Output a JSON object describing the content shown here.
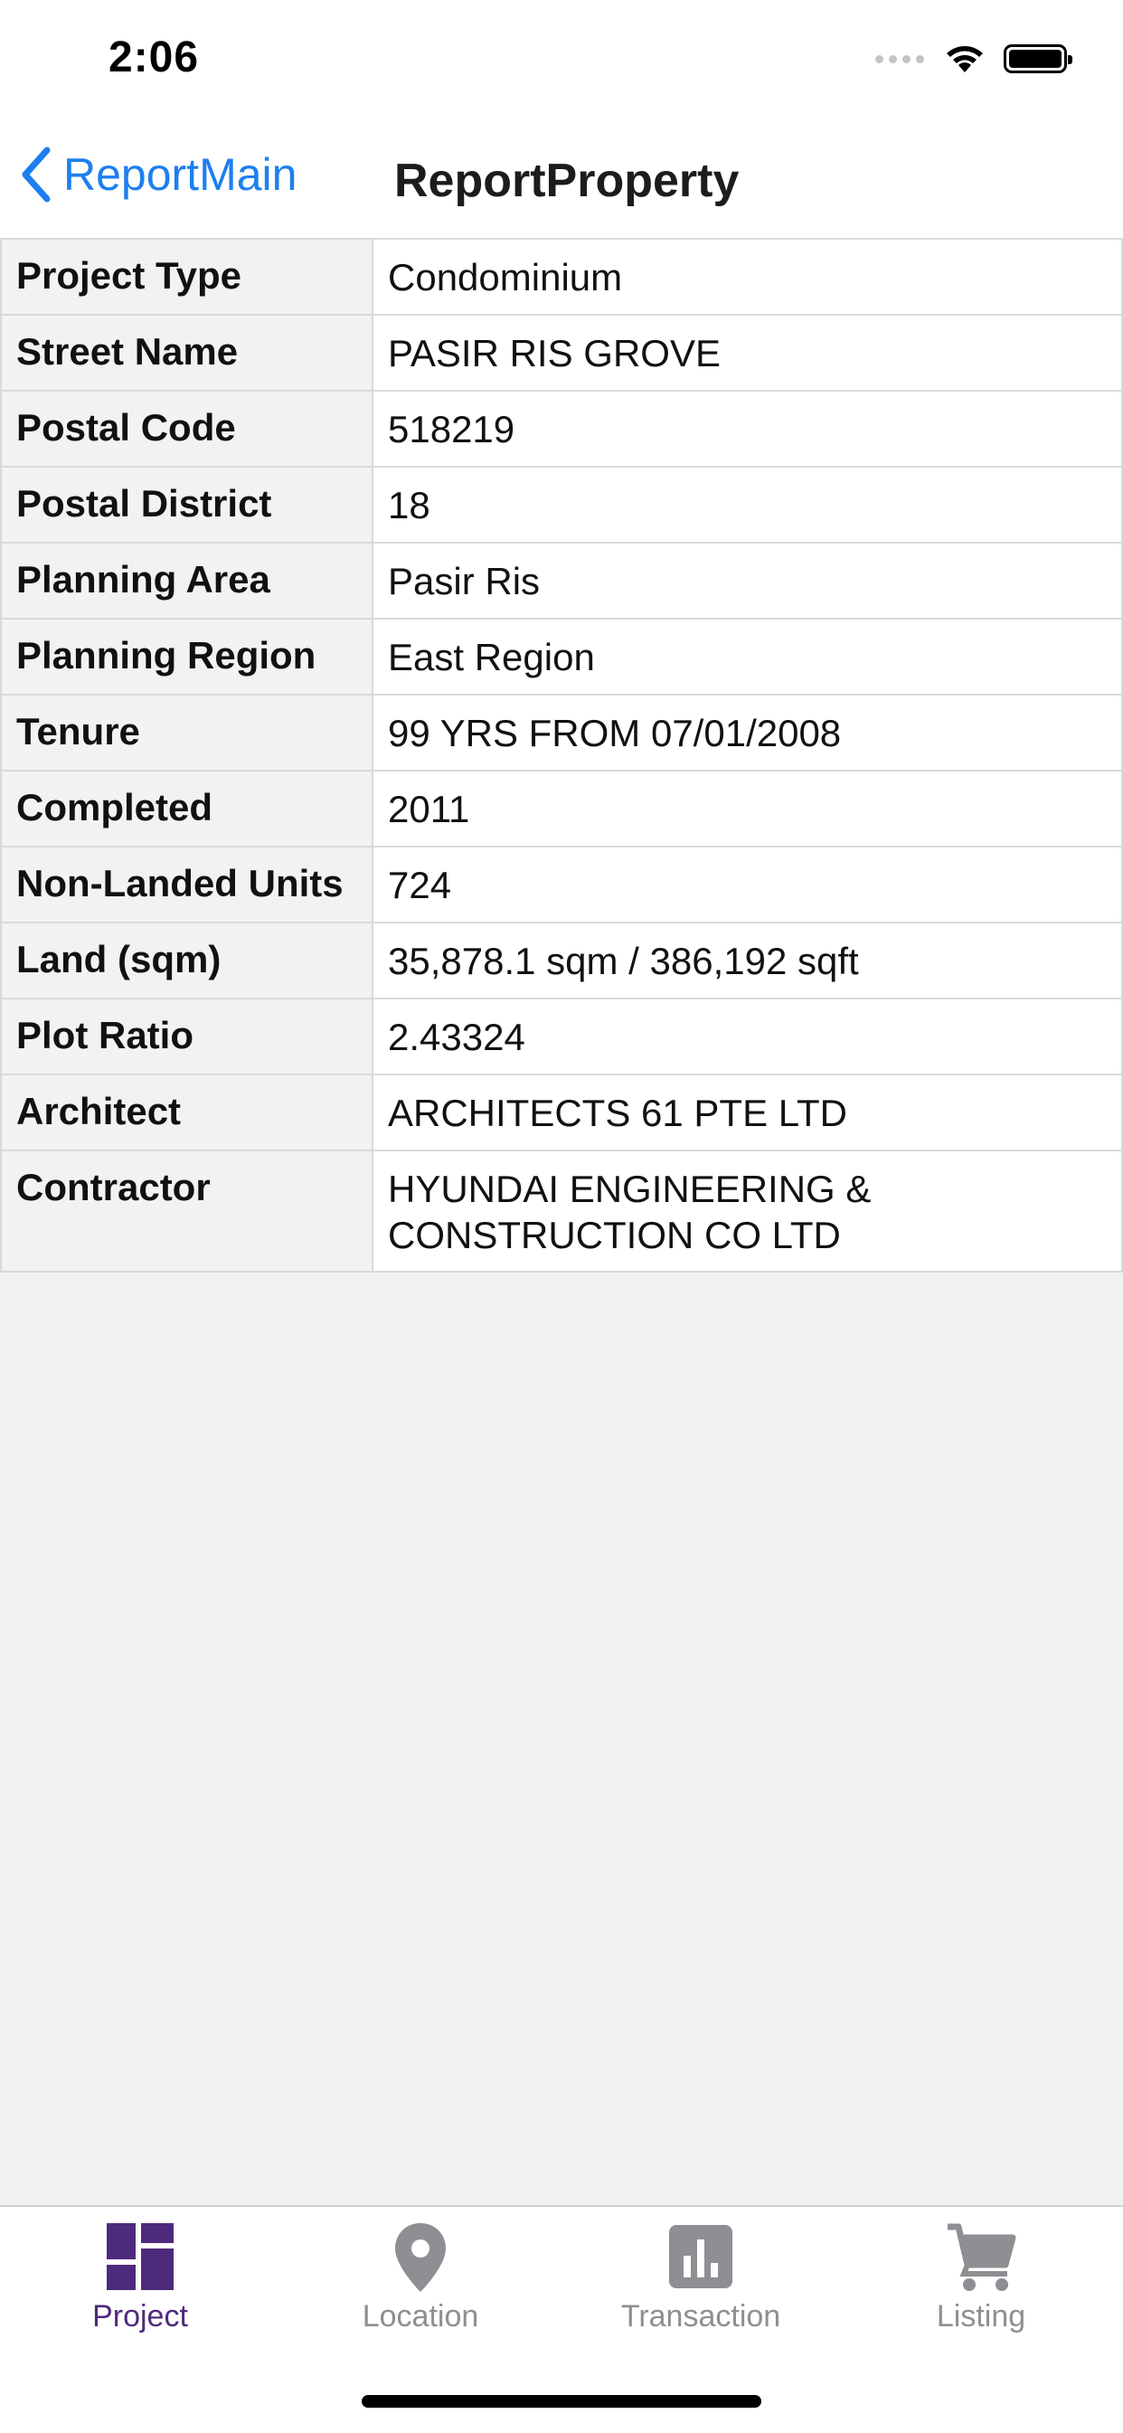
{
  "status_bar": {
    "time": "2:06"
  },
  "nav": {
    "back_label": "ReportMain",
    "title": "ReportProperty"
  },
  "properties": [
    {
      "key": "Project Type",
      "value": "Condominium"
    },
    {
      "key": "Street Name",
      "value": "PASIR RIS GROVE"
    },
    {
      "key": "Postal Code",
      "value": "518219"
    },
    {
      "key": "Postal District",
      "value": "18"
    },
    {
      "key": "Planning Area",
      "value": "Pasir Ris"
    },
    {
      "key": "Planning Region",
      "value": "East Region"
    },
    {
      "key": "Tenure",
      "value": "99 YRS FROM 07/01/2008"
    },
    {
      "key": "Completed",
      "value": "2011"
    },
    {
      "key": "Non-Landed Units",
      "value": "724"
    },
    {
      "key": "Land (sqm)",
      "value": "35,878.1 sqm / 386,192 sqft"
    },
    {
      "key": "Plot Ratio",
      "value": "2.43324"
    },
    {
      "key": "Architect",
      "value": "ARCHITECTS 61 PTE LTD"
    },
    {
      "key": "Contractor",
      "value": "HYUNDAI ENGINEERING & CONSTRUCTION CO LTD"
    }
  ],
  "tabs": [
    {
      "label": "Project",
      "icon": "dashboard-icon",
      "active": true
    },
    {
      "label": "Location",
      "icon": "map-pin-icon",
      "active": false
    },
    {
      "label": "Transaction",
      "icon": "bar-chart-icon",
      "active": false
    },
    {
      "label": "Listing",
      "icon": "shopping-cart-icon",
      "active": false
    }
  ],
  "colors": {
    "accent_blue": "#1d7ff0",
    "active_tab": "#4e2a7c",
    "inactive_tab": "#8e8e93"
  }
}
